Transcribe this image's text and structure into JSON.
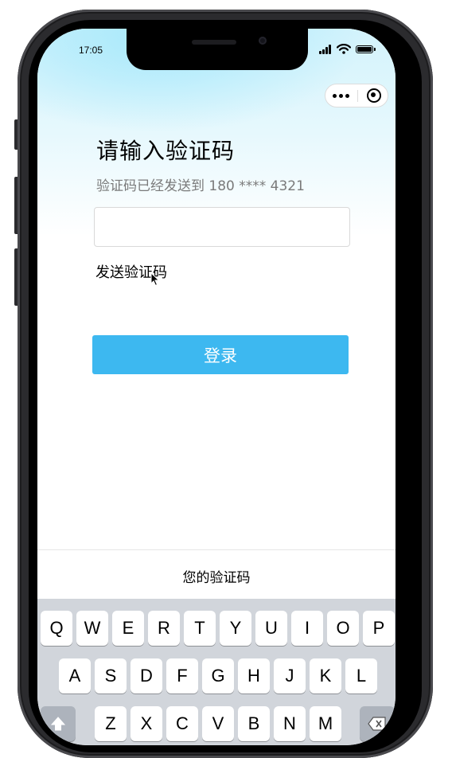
{
  "status_bar": {
    "time": "17:05",
    "signal_icon": "signal-bars-icon",
    "wifi_icon": "wifi-icon",
    "battery_icon": "battery-icon"
  },
  "capsule": {
    "more_icon": "more-dots-icon",
    "close_icon": "target-circle-icon"
  },
  "page": {
    "title": "请输入验证码",
    "subtitle": "验证码已经发送到 180 **** 4321",
    "code_input": {
      "value": "",
      "placeholder": ""
    },
    "send_code_label": "发送验证码",
    "login_label": "登录"
  },
  "keyboard": {
    "suggestion": "您的验证码",
    "rows": [
      [
        "Q",
        "W",
        "E",
        "R",
        "T",
        "Y",
        "U",
        "I",
        "O",
        "P"
      ],
      [
        "A",
        "S",
        "D",
        "F",
        "G",
        "H",
        "J",
        "K",
        "L"
      ],
      [
        "Z",
        "X",
        "C",
        "V",
        "B",
        "N",
        "M"
      ]
    ],
    "shift_icon": "shift-arrow-icon",
    "delete_icon": "backspace-icon"
  },
  "colors": {
    "accent": "#3db8f0",
    "text_secondary": "#7a7a7a",
    "keyboard_bg": "#d1d5db"
  }
}
